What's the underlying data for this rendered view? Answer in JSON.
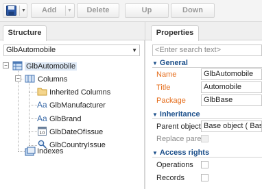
{
  "toolbar": {
    "add_label": "Add",
    "delete_label": "Delete",
    "up_label": "Up",
    "down_label": "Down"
  },
  "structure": {
    "tab_label": "Structure",
    "object_combo_value": "GlbAutomobile",
    "tree": {
      "root": "GlbAutomobile",
      "columns": "Columns",
      "inherited": "Inherited Columns",
      "col1": "GlbManufacturer",
      "col2": "GlbBrand",
      "col3": "GlbDateOfIssue",
      "col4": "GlbCountryIssue",
      "indexes": "Indexes"
    }
  },
  "properties": {
    "tab_label": "Properties",
    "search_placeholder": "<Enter search text>",
    "general": {
      "header": "General",
      "name_label": "Name",
      "name_value": "GlbAutomobile",
      "title_label": "Title",
      "title_value": "Automobile",
      "package_label": "Package",
      "package_value": "GlbBase"
    },
    "inheritance": {
      "header": "Inheritance",
      "parent_label": "Parent object",
      "parent_value": "Base object ( Base )",
      "replace_label": "Replace parent"
    },
    "access": {
      "header": "Access rights",
      "operations_label": "Operations",
      "records_label": "Records"
    }
  },
  "colors": {
    "section_header": "#1a4e8a",
    "required_label": "#e46a17",
    "selection": "#dde8f5"
  }
}
